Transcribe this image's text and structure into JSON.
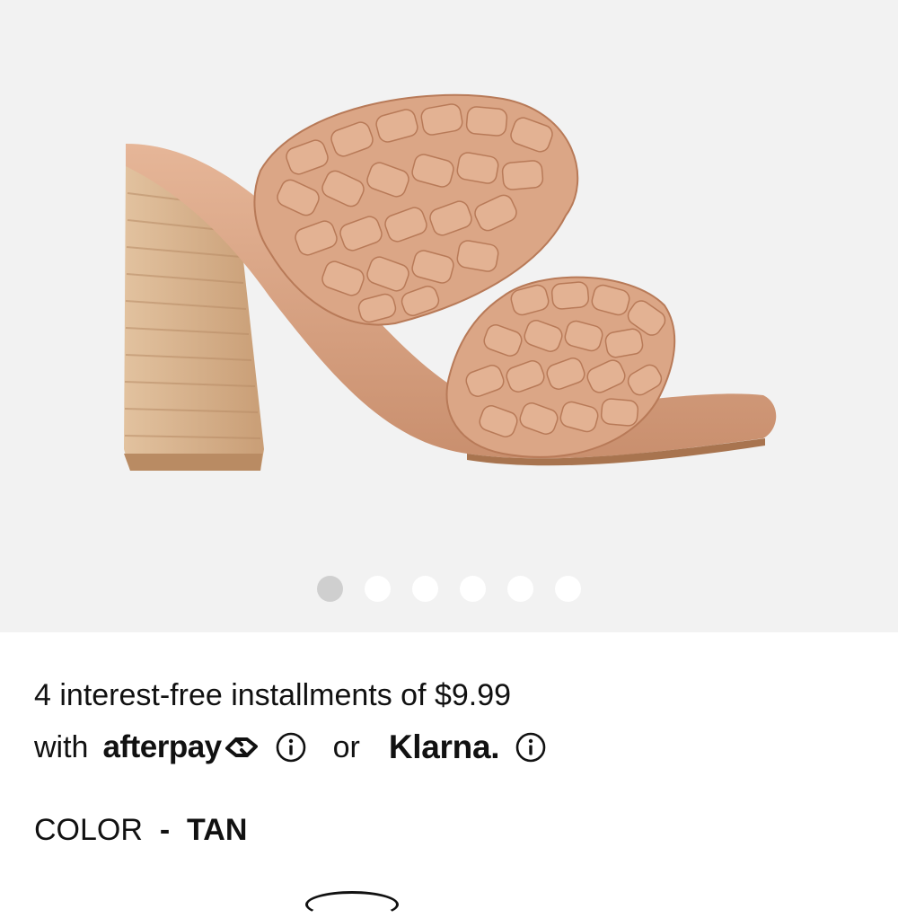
{
  "gallery": {
    "image_alt": "Tan braided double-strap block heel sandal",
    "dot_count": 6,
    "active_dot": 0
  },
  "payment": {
    "installment_text": "4 interest-free installments of $9.99",
    "with_label": "with",
    "afterpay_label": "afterpay",
    "or_label": "or",
    "klarna_label": "Klarna."
  },
  "color": {
    "label": "COLOR",
    "separator": "-",
    "value": "TAN"
  },
  "icons": {
    "afterpay_info": "info-icon",
    "klarna_info": "info-icon",
    "afterpay_mark": "afterpay-arrows-icon"
  },
  "colors": {
    "gallery_bg": "#f2f2f2",
    "dot_active": "#cfcfcf",
    "dot_inactive": "#ffffff",
    "text": "#111111",
    "sandal_tan": "#dca788",
    "heel_wood": "#d8b28e"
  }
}
